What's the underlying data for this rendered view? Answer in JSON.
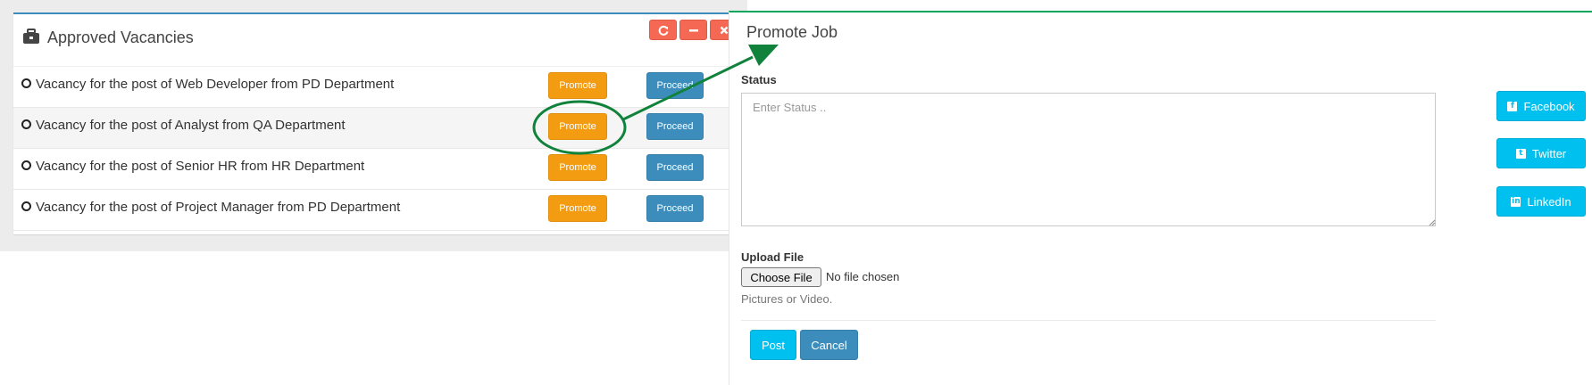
{
  "left_panel": {
    "title": "Approved Vacancies",
    "tools": {
      "refresh_icon": "refresh-icon",
      "minimize_icon": "minus-icon",
      "close_icon": "close-icon"
    },
    "vacancies": [
      {
        "text": "Vacancy for the post of Web Developer from PD Department",
        "promote_label": "Promote",
        "proceed_label": "Proceed"
      },
      {
        "text": "Vacancy for the post of Analyst from QA Department",
        "promote_label": "Promote",
        "proceed_label": "Proceed"
      },
      {
        "text": "Vacancy for the post of Senior HR from HR Department",
        "promote_label": "Promote",
        "proceed_label": "Proceed"
      },
      {
        "text": "Vacancy for the post of Project Manager from PD Department",
        "promote_label": "Promote",
        "proceed_label": "Proceed"
      }
    ]
  },
  "right_panel": {
    "title": "Promote Job",
    "status_label": "Status",
    "status_placeholder": "Enter Status ..",
    "upload_label": "Upload File",
    "file_button": "Choose File",
    "file_status": "No file chosen",
    "help_text": "Pictures or Video.",
    "post_label": "Post",
    "cancel_label": "Cancel",
    "social": [
      {
        "label": "Facebook",
        "icon": "facebook-icon"
      },
      {
        "label": "Twitter",
        "icon": "twitter-icon"
      },
      {
        "label": "LinkedIn",
        "icon": "linkedin-icon"
      }
    ]
  },
  "annotation": {
    "highlight": "circle",
    "arrow_color": "#11823b"
  },
  "colors": {
    "primary": "#3c8dbc",
    "warning": "#f39c12",
    "danger": "#f56954",
    "info": "#00c0ef",
    "success": "#00a65a"
  }
}
